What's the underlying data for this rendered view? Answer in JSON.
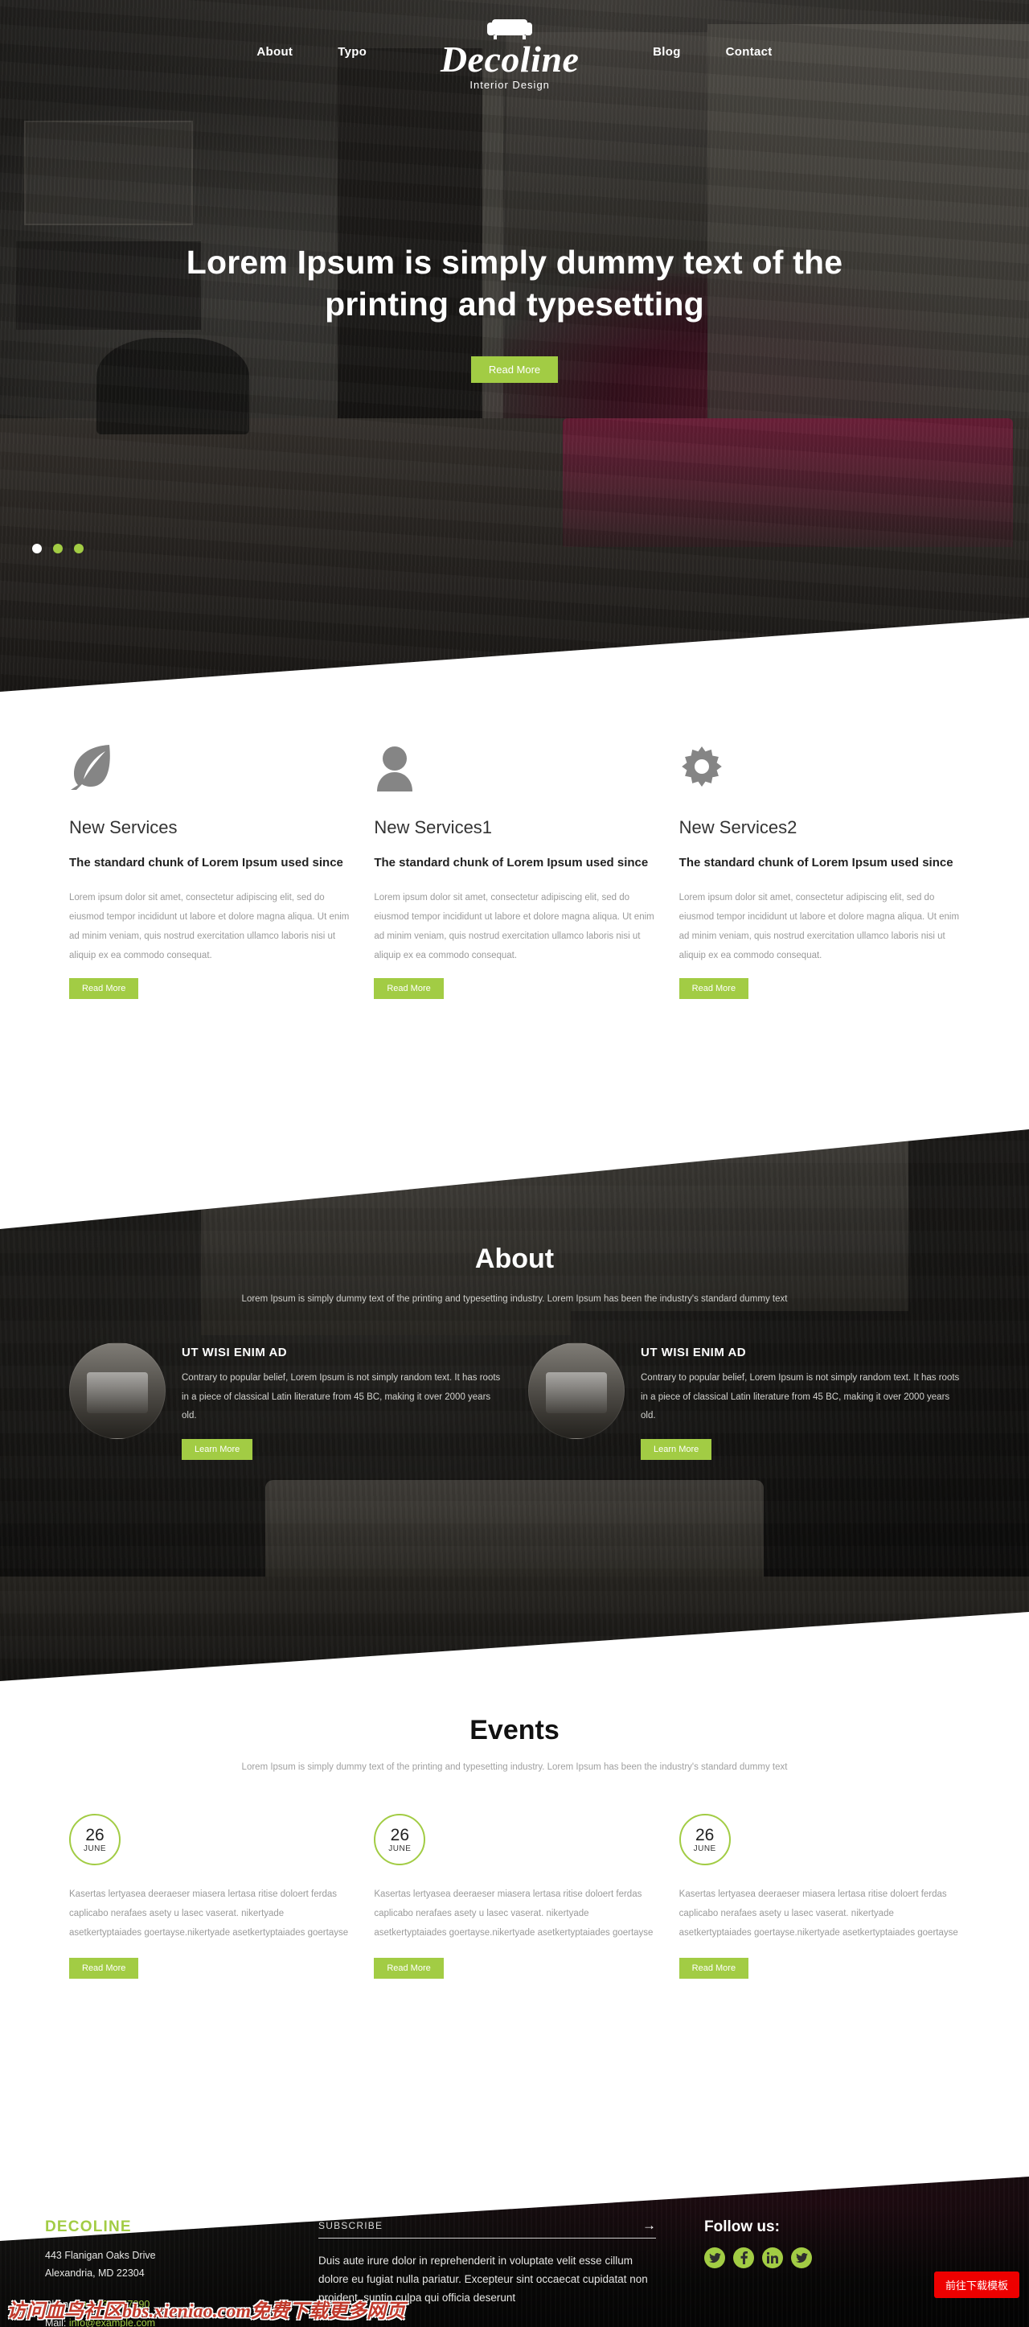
{
  "nav": {
    "left": [
      {
        "label": "About"
      },
      {
        "label": "Typo"
      }
    ],
    "right": [
      {
        "label": "Blog"
      },
      {
        "label": "Contact"
      }
    ],
    "brand": {
      "name": "Decoline",
      "tagline": "Interior  Design",
      "icon": "sofa-icon"
    }
  },
  "hero": {
    "title": "Lorem Ipsum is simply dummy text of the printing and typesetting",
    "button": "Read More",
    "dots": [
      {
        "active": true
      },
      {
        "active": false
      },
      {
        "active": false
      }
    ]
  },
  "services": [
    {
      "icon": "leaf-icon",
      "name": "New Services",
      "subtitle": "The standard chunk of Lorem Ipsum used since",
      "text": "Lorem ipsum dolor sit amet, consectetur adipiscing elit, sed do eiusmod tempor incididunt ut labore et dolore magna aliqua. Ut enim ad minim veniam, quis nostrud exercitation ullamco laboris nisi ut aliquip ex ea commodo consequat.",
      "button": "Read More"
    },
    {
      "icon": "person-icon",
      "name": "New Services1",
      "subtitle": "The standard chunk of Lorem Ipsum used since",
      "text": "Lorem ipsum dolor sit amet, consectetur adipiscing elit, sed do eiusmod tempor incididunt ut labore et dolore magna aliqua. Ut enim ad minim veniam, quis nostrud exercitation ullamco laboris nisi ut aliquip ex ea commodo consequat.",
      "button": "Read More"
    },
    {
      "icon": "gear-icon",
      "name": "New Services2",
      "subtitle": "The standard chunk of Lorem Ipsum used since",
      "text": "Lorem ipsum dolor sit amet, consectetur adipiscing elit, sed do eiusmod tempor incididunt ut labore et dolore magna aliqua. Ut enim ad minim veniam, quis nostrud exercitation ullamco laboris nisi ut aliquip ex ea commodo consequat.",
      "button": "Read More"
    }
  ],
  "about": {
    "title": "About",
    "subtitle": "Lorem Ipsum is simply dummy text of the printing and typesetting industry. Lorem Ipsum has been the industry's standard dummy text",
    "columns": [
      {
        "heading": "UT WISI ENIM AD",
        "text": "Contrary to popular belief, Lorem Ipsum is not simply random text. It has roots in a piece of classical Latin literature from 45 BC, making it over 2000 years old.",
        "button": "Learn More"
      },
      {
        "heading": "UT WISI ENIM AD",
        "text": "Contrary to popular belief, Lorem Ipsum is not simply random text. It has roots in a piece of classical Latin literature from 45 BC, making it over 2000 years old.",
        "button": "Learn More"
      }
    ]
  },
  "events": {
    "title": "Events",
    "subtitle": "Lorem Ipsum is simply dummy text of the printing and typesetting industry. Lorem Ipsum has been the industry's standard dummy text",
    "items": [
      {
        "day": "26",
        "month": "JUNE",
        "text": "Kasertas lertyasea deeraeser miasera lertasa ritise doloert ferdas caplicabo nerafaes asety u lasec vaserat. nikertyade asetkertyptaiades goertayse.nikertyade asetkertyptaiades goertayse",
        "button": "Read More"
      },
      {
        "day": "26",
        "month": "JUNE",
        "text": "Kasertas lertyasea deeraeser miasera lertasa ritise doloert ferdas caplicabo nerafaes asety u lasec vaserat. nikertyade asetkertyptaiades goertayse.nikertyade asetkertyptaiades goertayse",
        "button": "Read More"
      },
      {
        "day": "26",
        "month": "JUNE",
        "text": "Kasertas lertyasea deeraeser miasera lertasa ritise doloert ferdas caplicabo nerafaes asety u lasec vaserat. nikertyade asetkertyptaiades goertayse.nikertyade asetkertyptaiades goertayse",
        "button": "Read More"
      }
    ]
  },
  "footer": {
    "logo": "DECOLINE",
    "address_line1": "443 Flanigan Oaks Drive",
    "address_line2": "Alexandria, MD 22304",
    "phone_label": "Phone : ",
    "phone_value": "+1 234 567890",
    "mail_label": "Mail: ",
    "mail_value": "info@example.com",
    "subscribe_placeholder": "SUBSCRIBE",
    "subscribe_value": "",
    "subscribe_arrow": "→",
    "paragraph": "Duis aute irure dolor in reprehenderit in voluptate velit esse cillum dolore eu fugiat nulla pariatur. Excepteur sint occaecat cupidatat non proident, suntin culpa qui officia deserunt",
    "follow_label": "Follow us:",
    "socials": [
      {
        "icon": "twitter-icon"
      },
      {
        "icon": "facebook-icon"
      },
      {
        "icon": "linkedin-icon"
      },
      {
        "icon": "twitter-icon"
      }
    ]
  },
  "overlay": {
    "watermark": "访问血鸟社区bbs.xieniao.com免费下载更多网页",
    "download_button": "前往下载模板"
  },
  "theme": {
    "accent_green": "#A2CC44",
    "download_red": "#EE0000"
  }
}
